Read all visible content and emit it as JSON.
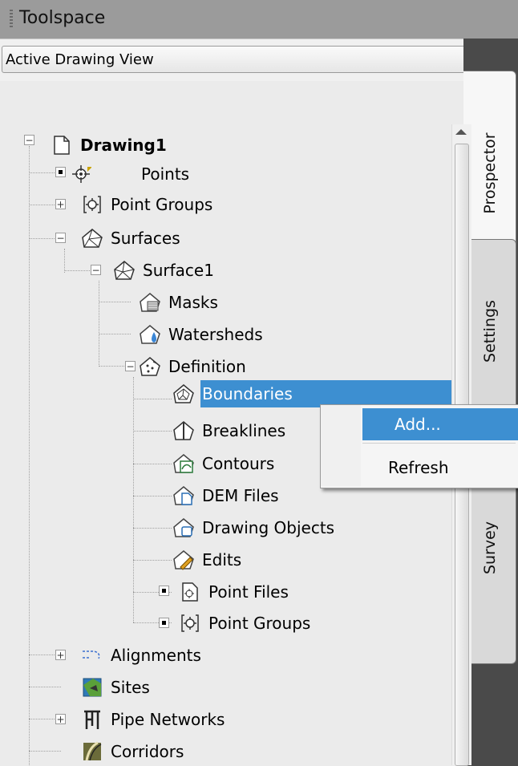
{
  "titlebar": {
    "title": "Toolspace"
  },
  "toolbar": {
    "icons": [
      "preview-icon",
      "item-view-icon",
      "panel-toggle-icon",
      "help-icon"
    ],
    "help_label": "?"
  },
  "view_selector": {
    "value": "Active Drawing View"
  },
  "tabs": [
    {
      "label": "Prospector"
    },
    {
      "label": "Settings"
    },
    {
      "label": "Survey"
    }
  ],
  "tree": {
    "items": [
      {
        "label": "Drawing1",
        "icon": "drawing-icon"
      },
      {
        "label": "Points",
        "icon": "point-icon"
      },
      {
        "label": "Point Groups",
        "icon": "point-group-icon"
      },
      {
        "label": "Surfaces",
        "icon": "surfaces-icon"
      },
      {
        "label": "Surface1",
        "icon": "surface-icon"
      },
      {
        "label": "Masks",
        "icon": "masks-icon"
      },
      {
        "label": "Watersheds",
        "icon": "watersheds-icon"
      },
      {
        "label": "Definition",
        "icon": "definition-icon"
      },
      {
        "label": "Boundaries",
        "icon": "boundaries-icon"
      },
      {
        "label": "Breaklines",
        "icon": "breaklines-icon"
      },
      {
        "label": "Contours",
        "icon": "contours-icon"
      },
      {
        "label": "DEM Files",
        "icon": "dem-files-icon"
      },
      {
        "label": "Drawing Objects",
        "icon": "drawing-objects-icon"
      },
      {
        "label": "Edits",
        "icon": "edits-icon"
      },
      {
        "label": "Point Files",
        "icon": "point-files-icon"
      },
      {
        "label": "Point Groups",
        "icon": "point-groups-icon"
      },
      {
        "label": "Alignments",
        "icon": "alignments-icon"
      },
      {
        "label": "Sites",
        "icon": "sites-icon"
      },
      {
        "label": "Pipe Networks",
        "icon": "pipe-networks-icon"
      },
      {
        "label": "Corridors",
        "icon": "corridors-icon"
      }
    ],
    "selected": "Boundaries"
  },
  "context_menu": {
    "items": [
      {
        "label": "Add..."
      },
      {
        "label": "Refresh"
      }
    ],
    "highlighted": "Add..."
  },
  "colors": {
    "selection": "#3d8fd1",
    "titlebar": "#9b9b9b",
    "panel": "#ebebeb"
  }
}
